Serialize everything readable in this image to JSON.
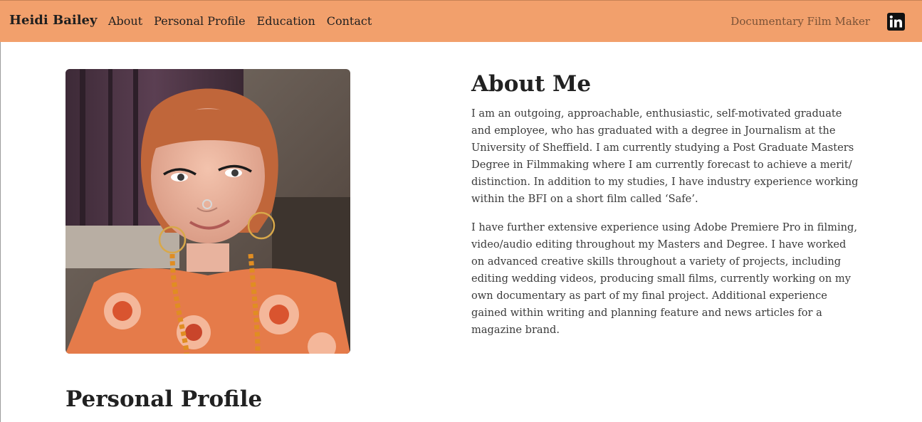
{
  "navbar": {
    "brand": "Heidi Bailey",
    "links": [
      {
        "label": "About"
      },
      {
        "label": "Personal Profile"
      },
      {
        "label": "Education"
      },
      {
        "label": "Contact"
      }
    ],
    "tagline": "Documentary Film Maker",
    "social_icon": "linkedin-icon",
    "background_color": "#f2a06c"
  },
  "about": {
    "title": "About Me",
    "paragraphs": [
      "I am an outgoing, approachable, enthusiastic, self-motivated graduate and employee, who has graduated with a degree in Journalism at the University of Sheffield. I am currently studying a Post Graduate Masters Degree in Filmmaking where I am currently forecast to achieve a merit/ distinction. In addition to my studies, I have industry experience working within the BFI on a short film called ‘Safe’.",
      "I have further extensive experience using Adobe Premiere Pro in filming, video/audio editing throughout my Masters and Degree. I have worked on advanced creative skills throughout a variety of projects, including editing wedding videos, producing small films, currently working on my own documentary as part of my final project. Additional experience gained within writing and planning feature and news articles for a magazine brand."
    ]
  },
  "profile": {
    "title": "Personal Profile"
  }
}
